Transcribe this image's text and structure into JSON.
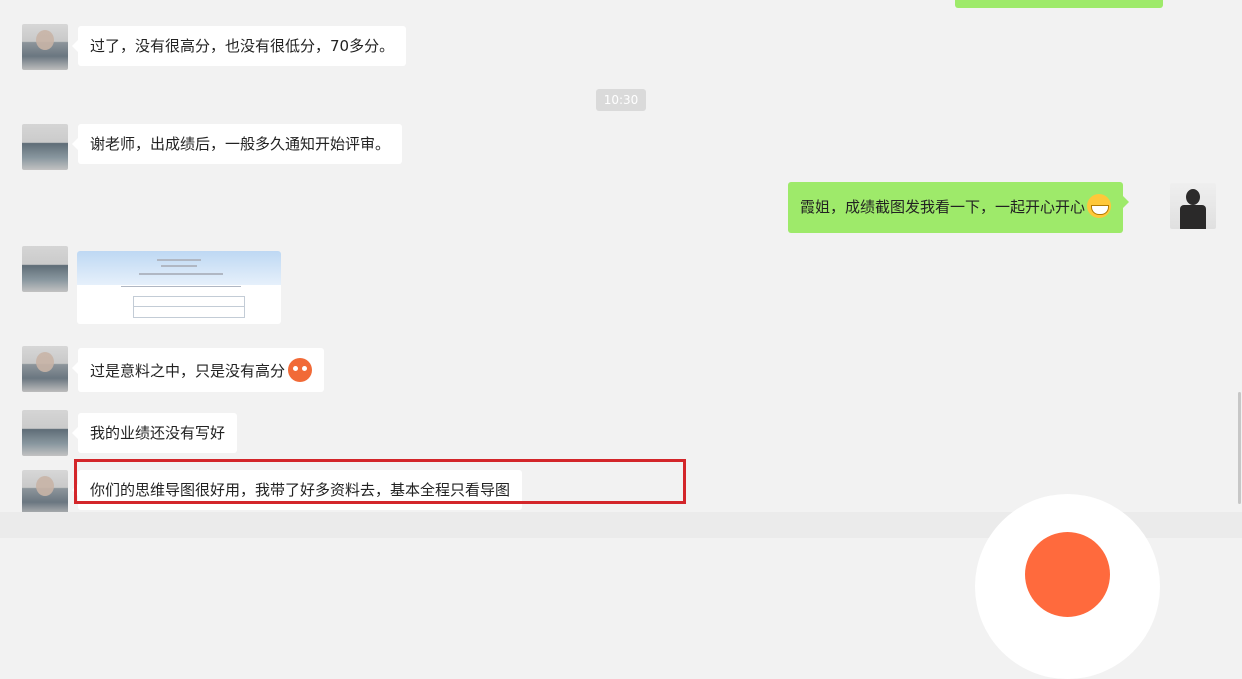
{
  "messages": [
    {
      "side": "left",
      "text": "过了，没有很高分，也没有很低分，70多分。"
    },
    {
      "side": "left",
      "text": "谢老师，出成绩后，一般多久通知开始评审。"
    },
    {
      "side": "right",
      "text": "霞姐，成绩截图发我看一下，一起开心开心",
      "emoji": "grin-emoji"
    },
    {
      "side": "left",
      "type": "image",
      "alt": "score-screenshot"
    },
    {
      "side": "left",
      "text": "过是意料之中，只是没有高分",
      "emoji": "sad-emoji"
    },
    {
      "side": "left",
      "text": "我的业绩还没有写好"
    },
    {
      "side": "left",
      "text": "你们的思维导图很好用，我带了好多资料去，基本全程只看导图",
      "highlighted": true
    }
  ],
  "timestamp": "10:30",
  "colors": {
    "background": "#f2f2f2",
    "my_bubble": "#9eea6a",
    "their_bubble": "#ffffff",
    "highlight_border": "#d3262a",
    "fab_accent": "#ff6a3d"
  }
}
